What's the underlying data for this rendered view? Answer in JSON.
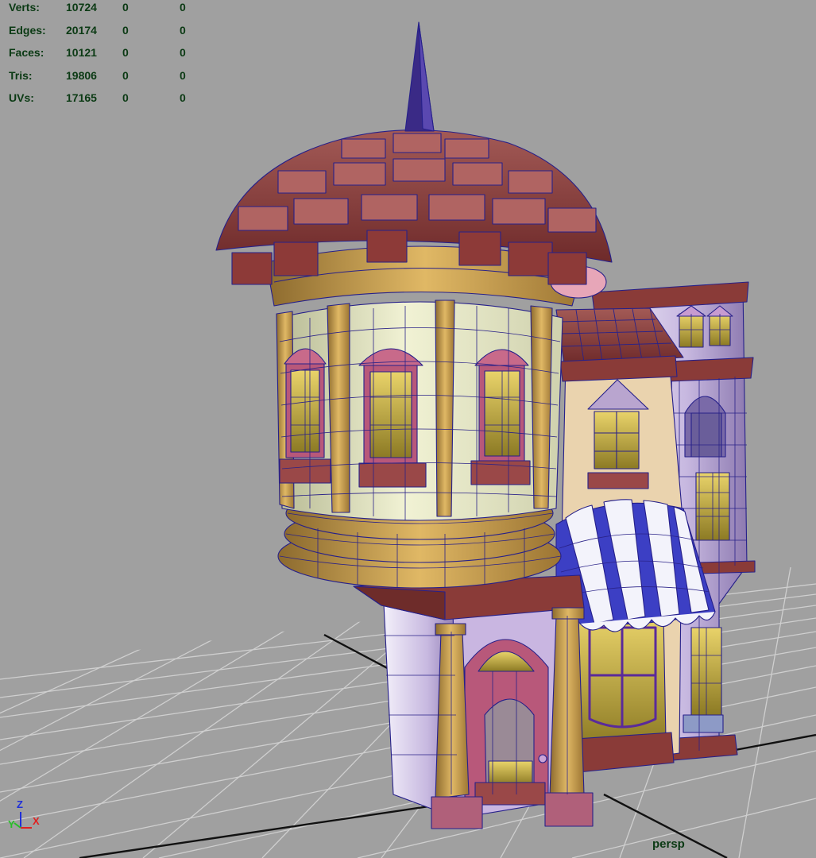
{
  "stats": [
    {
      "label": "Verts:",
      "count": "10724",
      "selected": "0",
      "triangles": "0"
    },
    {
      "label": "Edges:",
      "count": "20174",
      "selected": "0",
      "triangles": "0"
    },
    {
      "label": "Faces:",
      "count": "10121",
      "selected": "0",
      "triangles": "0"
    },
    {
      "label": "Tris:",
      "count": "19806",
      "selected": "0",
      "triangles": "0"
    },
    {
      "label": "UVs:",
      "count": "17165",
      "selected": "0",
      "triangles": "0"
    }
  ],
  "camera": {
    "name": "persp"
  },
  "axes": {
    "z": "Z",
    "x": "X",
    "y": "Y"
  },
  "colors": {
    "viewport_bg": "#a0a0a0",
    "grid_line": "#cfcfcf",
    "grid_axis": "#111111",
    "hud_text": "#0b3a14",
    "wireframe": "#26208a",
    "roof": "#8c3a38",
    "wood": "#c49a46",
    "plaster": "#dfe3b8",
    "wall": "#b7a4d4",
    "awning_blue": "#3c3fc4"
  }
}
